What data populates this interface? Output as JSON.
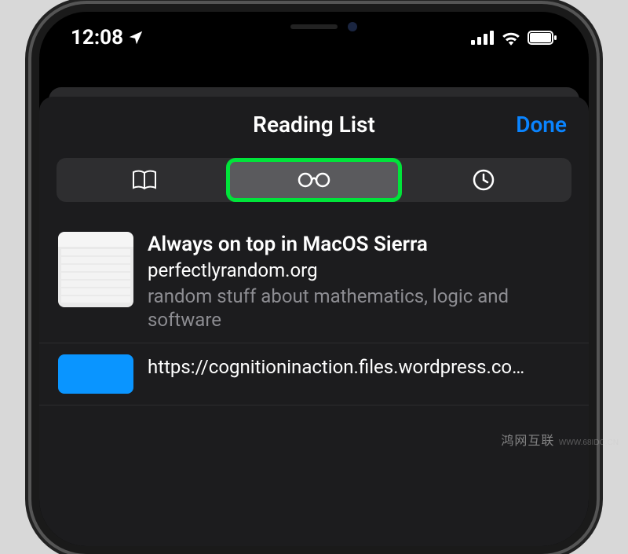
{
  "status": {
    "time": "12:08",
    "location_icon": "location-arrow"
  },
  "sheet": {
    "title": "Reading List",
    "done_label": "Done"
  },
  "segments": {
    "bookmarks_icon": "book-icon",
    "reading_list_icon": "glasses-icon",
    "history_icon": "clock-icon"
  },
  "items": [
    {
      "title": "Always on top in MacOS Sierra",
      "domain": "perfectlyrandom.org",
      "desc": "random stuff about mathematics, logic and software"
    },
    {
      "title": "https://cognitioninaction.files.wordpress.co…",
      "domain": "",
      "desc": ""
    }
  ],
  "watermark": {
    "text": "鸿网互联",
    "sub": "WWW.68IDC.CN"
  }
}
